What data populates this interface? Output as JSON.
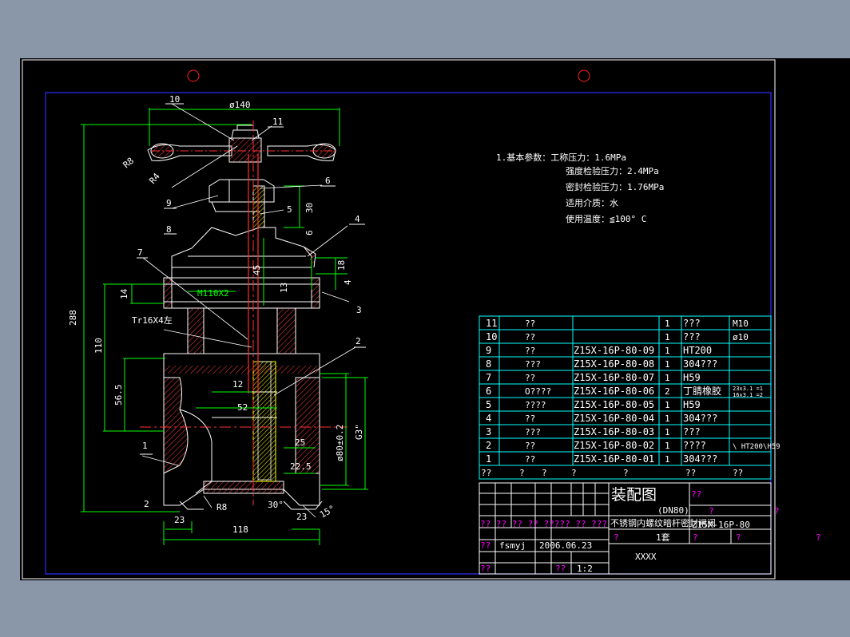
{
  "drawing": {
    "notes": {
      "line1": "1.基本参数：工称压力：1.6MPa",
      "line2": "强度检验压力：2.4MPa",
      "line3": "密封检验压力：1.76MPa",
      "line4": "适用介质：水",
      "line5": "使用温度：≦100° C"
    },
    "dimensions": {
      "d140": "ø140",
      "d288": "288",
      "d110": "110",
      "d56_5": "56.5",
      "d14": "14",
      "m110": "M110X2",
      "tr16": "Tr16X4左",
      "d30": "30",
      "d6": "6",
      "d45": "45",
      "d13": "13",
      "d18": "18",
      "d4": "4",
      "d12": "12",
      "d52": "52",
      "d25": "25",
      "d22_5": "22.5",
      "d80": "ø80±0.2",
      "g3": "G3\"",
      "d2": "2",
      "d23a": "23",
      "d118": "118",
      "r8b": "R8",
      "a30": "30°",
      "d23b": "23",
      "a15": "15°",
      "r8a": "R8",
      "r4": "R4"
    },
    "balloons": {
      "b1": "1",
      "b2": "2",
      "b3": "3",
      "b4": "4",
      "b5": "5",
      "b6": "6",
      "b7": "7",
      "b8": "8",
      "b9": "9",
      "b10": "10",
      "b11": "11"
    },
    "parts_list": [
      {
        "no": "11",
        "name": "??",
        "code": "",
        "qty": "1",
        "material": "???",
        "note": "M10"
      },
      {
        "no": "10",
        "name": "??",
        "code": "",
        "qty": "1",
        "material": "???",
        "note": "ø10"
      },
      {
        "no": "9",
        "name": "??",
        "code": "Z15X-16P-80-09",
        "qty": "1",
        "material": "HT200",
        "note": ""
      },
      {
        "no": "8",
        "name": "???",
        "code": "Z15X-16P-80-08",
        "qty": "1",
        "material": "304???",
        "note": ""
      },
      {
        "no": "7",
        "name": "??",
        "code": "Z15X-16P-80-07",
        "qty": "1",
        "material": "H59",
        "note": ""
      },
      {
        "no": "6",
        "name": "O????",
        "code": "Z15X-16P-80-06",
        "qty": "2",
        "material": "丁腈橡胶",
        "note": "23x3.1 =1\n16x3.1 =2"
      },
      {
        "no": "5",
        "name": "????",
        "code": "Z15X-16P-80-05",
        "qty": "1",
        "material": "H59",
        "note": ""
      },
      {
        "no": "4",
        "name": "??",
        "code": "Z15X-16P-80-04",
        "qty": "1",
        "material": "304???",
        "note": ""
      },
      {
        "no": "3",
        "name": "???",
        "code": "Z15X-16P-80-03",
        "qty": "1",
        "material": "???",
        "note": ""
      },
      {
        "no": "2",
        "name": "??",
        "code": "Z15X-16P-80-02",
        "qty": "1",
        "material": "????",
        "note": "\\ HT200\\H59"
      },
      {
        "no": "1",
        "name": "??",
        "code": "Z15X-16P-80-01",
        "qty": "1",
        "material": "304???",
        "note": ""
      }
    ],
    "parts_header": [
      "??",
      "?",
      "?",
      "?",
      "?",
      "??",
      "??"
    ],
    "title_block": {
      "title": "装配图",
      "subtitle": "(DN80)",
      "product": "不锈钢内螺纹暗杆密封闸阀",
      "drawing_no": "Z15X-16P-80",
      "designer": "fsmyj",
      "date": "2006.06.23",
      "quantity": "1套",
      "company": "XXXX",
      "scale": "1:2",
      "row_labels": "?? ?? ?? ?? ????? ?? ???",
      "q1": "??",
      "q2": "?",
      "q3": "?",
      "q4": "??",
      "q5": "?",
      "q6": "?",
      "q7": "?",
      "q8": "??",
      "q9": "?"
    }
  }
}
